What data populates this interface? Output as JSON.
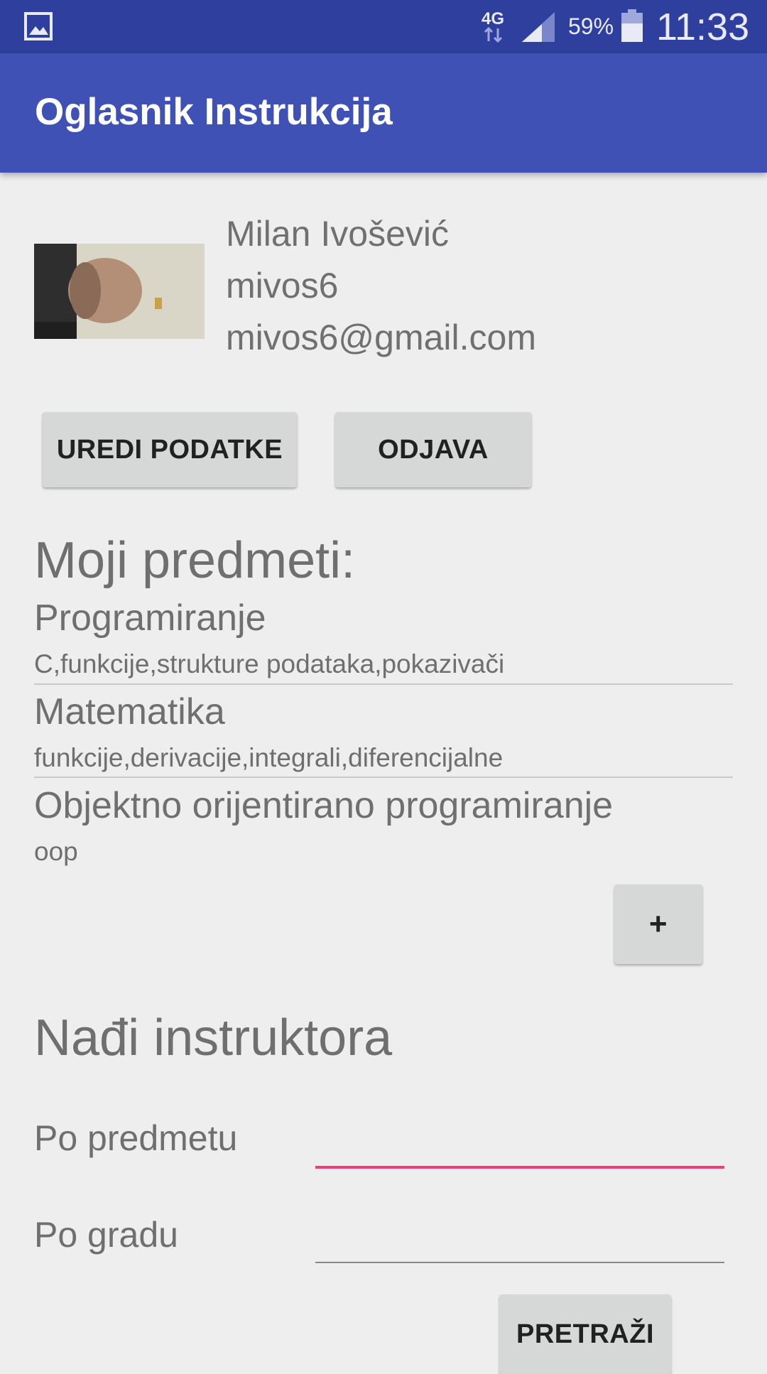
{
  "status_bar": {
    "network": "4G",
    "battery": "59%",
    "time": "11:33",
    "icons": [
      "gallery-icon",
      "network-arrows-icon",
      "signal-icon",
      "battery-icon"
    ]
  },
  "app_bar": {
    "title": "Oglasnik Instrukcija"
  },
  "profile": {
    "name": "Milan Ivošević",
    "username": "mivos6",
    "email": "mivos6@gmail.com"
  },
  "actions": {
    "edit_label": "UREDI PODATKE",
    "logout_label": "ODJAVA"
  },
  "my_subjects": {
    "title": "Moji predmeti:",
    "items": [
      {
        "name": "Programiranje",
        "description": "C,funkcije,strukture podataka,pokazivači"
      },
      {
        "name": "Matematika",
        "description": "funkcije,derivacije,integrali,diferencijalne"
      },
      {
        "name": "Objektno orijentirano programiranje",
        "description": "oop"
      }
    ],
    "add_label": "+"
  },
  "search": {
    "title": "Nađi instruktora",
    "by_subject_label": "Po predmetu",
    "by_subject_value": "",
    "by_city_label": "Po gradu",
    "by_city_value": "",
    "submit_label": "PRETRAŽI"
  },
  "colors": {
    "status_bar": "#2f3f9e",
    "app_bar": "#3f51b5",
    "accent": "#ec407a",
    "background": "#eeeeee",
    "button": "#d6d7d7"
  }
}
